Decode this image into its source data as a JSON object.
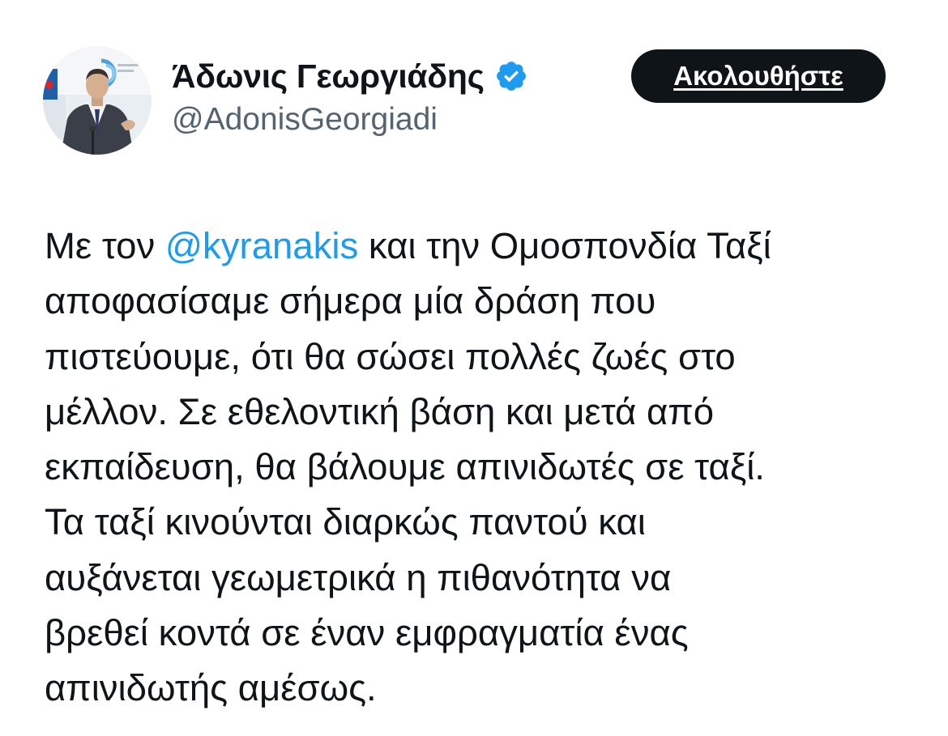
{
  "author": {
    "display_name": "Άδωνις Γεωργιάδης",
    "handle": "@AdonisGeorgiadi",
    "verified": true,
    "verified_color": "#1d9bf0",
    "avatar_icon": "profile-photo"
  },
  "follow_button": {
    "label": "Ακολουθήστε",
    "background": "#0f1419",
    "text_color": "#ffffff"
  },
  "tweet": {
    "mention": "@kyranakis",
    "mention_color": "#1d9bf0",
    "line1_before": "Με τον ",
    "line1_after": " και την Ομοσπονδία Ταξί",
    "lines": [
      "αποφασίσαμε σήμερα μία δράση που",
      "πιστεύουμε, ότι θα σώσει πολλές ζωές στο",
      "μέλλον. Σε εθελοντική βάση και μετά από",
      "εκπαίδευση, θα βάλουμε απινιδωτές σε ταξί.",
      "Τα ταξί κινούνται διαρκώς παντού και",
      "αυξάνεται γεωμετρικά η πιθανότητα να",
      "βρεθεί κοντά σε έναν εμφραγματία ένας",
      "απινιδωτής αμέσως."
    ]
  }
}
